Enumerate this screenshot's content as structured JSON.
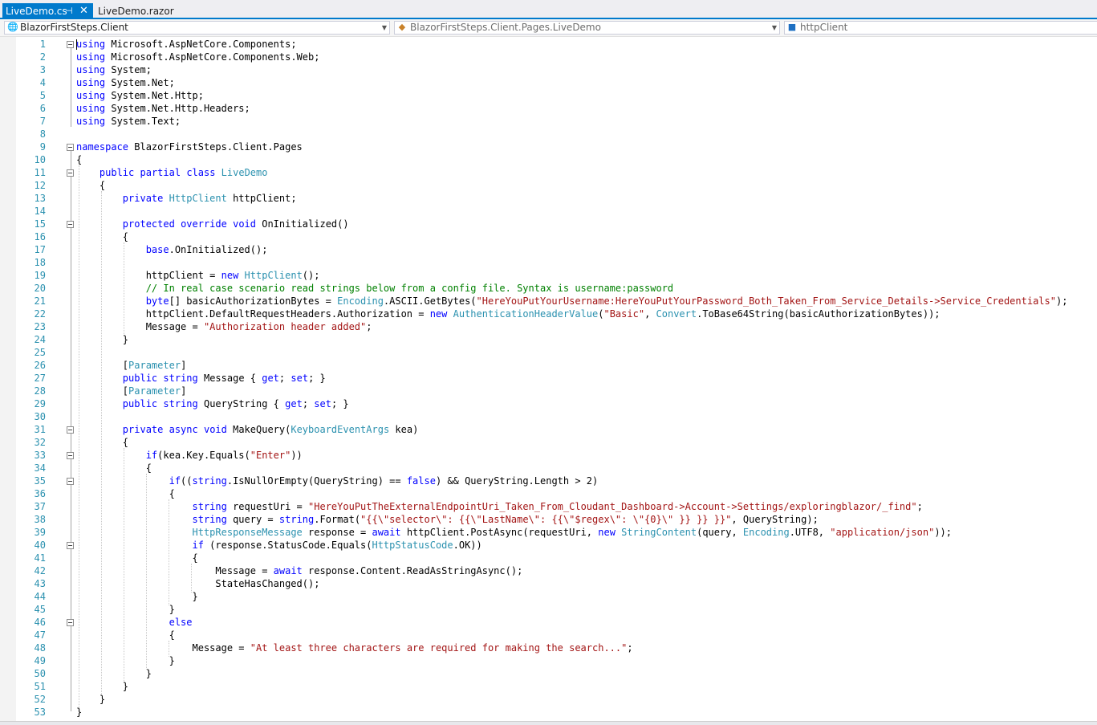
{
  "tabs": [
    {
      "label": "LiveDemo.cs",
      "active": true
    },
    {
      "label": "LiveDemo.razor",
      "active": false
    }
  ],
  "navbar": {
    "project": "BlazorFirstSteps.Client",
    "type": "BlazorFirstSteps.Client.Pages.LiveDemo",
    "member": "httpClient"
  },
  "colors": {
    "accent": "#007acc",
    "keyword": "#0000ff",
    "type": "#2b91af",
    "string": "#a31515",
    "comment": "#008000",
    "line_number": "#2b91af"
  },
  "code": [
    {
      "n": "1",
      "fold": true,
      "t": [
        [
          "kw",
          "using"
        ],
        [
          "",
          " Microsoft.AspNetCore.Components;"
        ]
      ]
    },
    {
      "n": "2",
      "t": [
        [
          "kw",
          "using"
        ],
        [
          "",
          " Microsoft.AspNetCore.Components.Web;"
        ]
      ]
    },
    {
      "n": "3",
      "t": [
        [
          "kw",
          "using"
        ],
        [
          "",
          " System;"
        ]
      ]
    },
    {
      "n": "4",
      "t": [
        [
          "kw",
          "using"
        ],
        [
          "",
          " System.Net;"
        ]
      ]
    },
    {
      "n": "5",
      "t": [
        [
          "kw",
          "using"
        ],
        [
          "",
          " System.Net.Http;"
        ]
      ]
    },
    {
      "n": "6",
      "t": [
        [
          "kw",
          "using"
        ],
        [
          "",
          " System.Net.Http.Headers;"
        ]
      ]
    },
    {
      "n": "7",
      "t": [
        [
          "kw",
          "using"
        ],
        [
          "",
          " System.Text;"
        ]
      ]
    },
    {
      "n": "8",
      "t": []
    },
    {
      "n": "9",
      "fold": true,
      "t": [
        [
          "kw",
          "namespace"
        ],
        [
          "",
          " BlazorFirstSteps.Client.Pages"
        ]
      ]
    },
    {
      "n": "10",
      "t": [
        [
          "",
          "{"
        ]
      ]
    },
    {
      "n": "11",
      "fold": true,
      "t": [
        [
          "",
          "    "
        ],
        [
          "kw",
          "public"
        ],
        [
          "",
          " "
        ],
        [
          "kw",
          "partial"
        ],
        [
          "",
          " "
        ],
        [
          "kw",
          "class"
        ],
        [
          "",
          " "
        ],
        [
          "ty",
          "LiveDemo"
        ]
      ]
    },
    {
      "n": "12",
      "t": [
        [
          "",
          "    {"
        ]
      ]
    },
    {
      "n": "13",
      "t": [
        [
          "",
          "        "
        ],
        [
          "kw",
          "private"
        ],
        [
          "",
          " "
        ],
        [
          "ty",
          "HttpClient"
        ],
        [
          "",
          " httpClient;"
        ]
      ]
    },
    {
      "n": "14",
      "t": []
    },
    {
      "n": "15",
      "fold": true,
      "t": [
        [
          "",
          "        "
        ],
        [
          "kw",
          "protected"
        ],
        [
          "",
          " "
        ],
        [
          "kw",
          "override"
        ],
        [
          "",
          " "
        ],
        [
          "kw",
          "void"
        ],
        [
          "",
          " OnInitialized()"
        ]
      ]
    },
    {
      "n": "16",
      "t": [
        [
          "",
          "        {"
        ]
      ]
    },
    {
      "n": "17",
      "t": [
        [
          "",
          "            "
        ],
        [
          "kw",
          "base"
        ],
        [
          "",
          ".OnInitialized();"
        ]
      ]
    },
    {
      "n": "18",
      "t": []
    },
    {
      "n": "19",
      "t": [
        [
          "",
          "            httpClient = "
        ],
        [
          "kw",
          "new"
        ],
        [
          "",
          " "
        ],
        [
          "ty",
          "HttpClient"
        ],
        [
          "",
          "();"
        ]
      ]
    },
    {
      "n": "20",
      "t": [
        [
          "",
          "            "
        ],
        [
          "cm",
          "// In real case scenario read strings below from a config file. Syntax is username:password"
        ]
      ]
    },
    {
      "n": "21",
      "t": [
        [
          "",
          "            "
        ],
        [
          "kw",
          "byte"
        ],
        [
          "",
          "[] basicAuthorizationBytes = "
        ],
        [
          "ty",
          "Encoding"
        ],
        [
          "",
          ".ASCII.GetBytes("
        ],
        [
          "st",
          "\"HereYouPutYourUsername:HereYouPutYourPassword_Both_Taken_From_Service_Details->Service_Credentials\""
        ],
        [
          "",
          ");"
        ]
      ]
    },
    {
      "n": "22",
      "t": [
        [
          "",
          "            httpClient.DefaultRequestHeaders.Authorization = "
        ],
        [
          "kw",
          "new"
        ],
        [
          "",
          " "
        ],
        [
          "ty",
          "AuthenticationHeaderValue"
        ],
        [
          "",
          "("
        ],
        [
          "st",
          "\"Basic\""
        ],
        [
          "",
          ", "
        ],
        [
          "ty",
          "Convert"
        ],
        [
          "",
          ".ToBase64String(basicAuthorizationBytes));"
        ]
      ]
    },
    {
      "n": "23",
      "t": [
        [
          "",
          "            Message = "
        ],
        [
          "st",
          "\"Authorization header added\""
        ],
        [
          "",
          ";"
        ]
      ]
    },
    {
      "n": "24",
      "t": [
        [
          "",
          "        }"
        ]
      ]
    },
    {
      "n": "25",
      "t": []
    },
    {
      "n": "26",
      "t": [
        [
          "",
          "        ["
        ],
        [
          "ty",
          "Parameter"
        ],
        [
          "",
          "]"
        ]
      ]
    },
    {
      "n": "27",
      "t": [
        [
          "",
          "        "
        ],
        [
          "kw",
          "public"
        ],
        [
          "",
          " "
        ],
        [
          "kw",
          "string"
        ],
        [
          "",
          " Message { "
        ],
        [
          "kw",
          "get"
        ],
        [
          "",
          "; "
        ],
        [
          "kw",
          "set"
        ],
        [
          "",
          "; }"
        ]
      ]
    },
    {
      "n": "28",
      "t": [
        [
          "",
          "        ["
        ],
        [
          "ty",
          "Parameter"
        ],
        [
          "",
          "]"
        ]
      ]
    },
    {
      "n": "29",
      "t": [
        [
          "",
          "        "
        ],
        [
          "kw",
          "public"
        ],
        [
          "",
          " "
        ],
        [
          "kw",
          "string"
        ],
        [
          "",
          " QueryString { "
        ],
        [
          "kw",
          "get"
        ],
        [
          "",
          "; "
        ],
        [
          "kw",
          "set"
        ],
        [
          "",
          "; }"
        ]
      ]
    },
    {
      "n": "30",
      "t": []
    },
    {
      "n": "31",
      "fold": true,
      "t": [
        [
          "",
          "        "
        ],
        [
          "kw",
          "private"
        ],
        [
          "",
          " "
        ],
        [
          "kw",
          "async"
        ],
        [
          "",
          " "
        ],
        [
          "kw",
          "void"
        ],
        [
          "",
          " MakeQuery("
        ],
        [
          "ty",
          "KeyboardEventArgs"
        ],
        [
          "",
          " kea)"
        ]
      ]
    },
    {
      "n": "32",
      "t": [
        [
          "",
          "        {"
        ]
      ]
    },
    {
      "n": "33",
      "fold": true,
      "t": [
        [
          "",
          "            "
        ],
        [
          "kw",
          "if"
        ],
        [
          "",
          "(kea.Key.Equals("
        ],
        [
          "st",
          "\"Enter\""
        ],
        [
          "",
          "))"
        ]
      ]
    },
    {
      "n": "34",
      "t": [
        [
          "",
          "            {"
        ]
      ]
    },
    {
      "n": "35",
      "fold": true,
      "t": [
        [
          "",
          "                "
        ],
        [
          "kw",
          "if"
        ],
        [
          "",
          "(("
        ],
        [
          "kw",
          "string"
        ],
        [
          "",
          ".IsNullOrEmpty(QueryString) == "
        ],
        [
          "kw",
          "false"
        ],
        [
          "",
          ") && QueryString.Length > 2)"
        ]
      ]
    },
    {
      "n": "36",
      "t": [
        [
          "",
          "                {"
        ]
      ]
    },
    {
      "n": "37",
      "t": [
        [
          "",
          "                    "
        ],
        [
          "kw",
          "string"
        ],
        [
          "",
          " requestUri = "
        ],
        [
          "st",
          "\"HereYouPutTheExternalEndpointUri_Taken_From_Cloudant_Dashboard->Account->Settings/exploringblazor/_find\""
        ],
        [
          "",
          ";"
        ]
      ]
    },
    {
      "n": "38",
      "t": [
        [
          "",
          "                    "
        ],
        [
          "kw",
          "string"
        ],
        [
          "",
          " query = "
        ],
        [
          "kw",
          "string"
        ],
        [
          "",
          ".Format("
        ],
        [
          "st",
          "\"{{\\\"selector\\\": {{\\\"LastName\\\": {{\\\"$regex\\\": \\\"{0}\\\" }} }} }}\""
        ],
        [
          "",
          ", QueryString);"
        ]
      ]
    },
    {
      "n": "39",
      "t": [
        [
          "",
          "                    "
        ],
        [
          "ty",
          "HttpResponseMessage"
        ],
        [
          "",
          " response = "
        ],
        [
          "kw",
          "await"
        ],
        [
          "",
          " httpClient.PostAsync(requestUri, "
        ],
        [
          "kw",
          "new"
        ],
        [
          "",
          " "
        ],
        [
          "ty",
          "StringContent"
        ],
        [
          "",
          "(query, "
        ],
        [
          "ty",
          "Encoding"
        ],
        [
          "",
          ".UTF8, "
        ],
        [
          "st",
          "\"application/json\""
        ],
        [
          "",
          "));"
        ]
      ]
    },
    {
      "n": "40",
      "fold": true,
      "t": [
        [
          "",
          "                    "
        ],
        [
          "kw",
          "if"
        ],
        [
          "",
          " (response.StatusCode.Equals("
        ],
        [
          "ty",
          "HttpStatusCode"
        ],
        [
          "",
          ".OK))"
        ]
      ]
    },
    {
      "n": "41",
      "t": [
        [
          "",
          "                    {"
        ]
      ]
    },
    {
      "n": "42",
      "t": [
        [
          "",
          "                        Message = "
        ],
        [
          "kw",
          "await"
        ],
        [
          "",
          " response.Content.ReadAsStringAsync();"
        ]
      ]
    },
    {
      "n": "43",
      "t": [
        [
          "",
          "                        StateHasChanged();"
        ]
      ]
    },
    {
      "n": "44",
      "t": [
        [
          "",
          "                    }"
        ]
      ]
    },
    {
      "n": "45",
      "t": [
        [
          "",
          "                }"
        ]
      ]
    },
    {
      "n": "46",
      "fold": true,
      "t": [
        [
          "",
          "                "
        ],
        [
          "kw",
          "else"
        ]
      ]
    },
    {
      "n": "47",
      "t": [
        [
          "",
          "                {"
        ]
      ]
    },
    {
      "n": "48",
      "t": [
        [
          "",
          "                    Message = "
        ],
        [
          "st",
          "\"At least three characters are required for making the search...\""
        ],
        [
          "",
          ";"
        ]
      ]
    },
    {
      "n": "49",
      "t": [
        [
          "",
          "                }"
        ]
      ]
    },
    {
      "n": "50",
      "t": [
        [
          "",
          "            }"
        ]
      ]
    },
    {
      "n": "51",
      "t": [
        [
          "",
          "        }"
        ]
      ]
    },
    {
      "n": "52",
      "t": [
        [
          "",
          "    }"
        ]
      ]
    },
    {
      "n": "53",
      "t": [
        [
          "",
          "}"
        ]
      ]
    }
  ]
}
